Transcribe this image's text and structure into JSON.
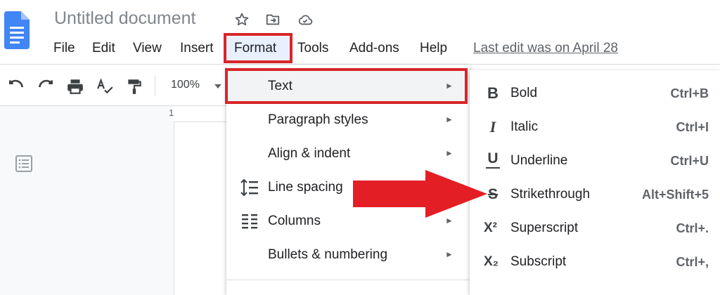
{
  "header": {
    "title": "Untitled document",
    "last_edit": "Last edit was on April 28"
  },
  "menubar": {
    "items": [
      "File",
      "Edit",
      "View",
      "Insert",
      "Format",
      "Tools",
      "Add-ons",
      "Help"
    ]
  },
  "toolbar": {
    "zoom": "100%"
  },
  "ruler": {
    "marker": "1"
  },
  "format_menu": {
    "items": [
      {
        "label": "Text"
      },
      {
        "label": "Paragraph styles"
      },
      {
        "label": "Align & indent"
      },
      {
        "label": "Line spacing"
      },
      {
        "label": "Columns"
      },
      {
        "label": "Bullets & numbering"
      }
    ],
    "arrow": "►"
  },
  "text_menu": {
    "items": [
      {
        "label": "Bold",
        "shortcut": "Ctrl+B",
        "icon": "B"
      },
      {
        "label": "Italic",
        "shortcut": "Ctrl+I",
        "icon": "I"
      },
      {
        "label": "Underline",
        "shortcut": "Ctrl+U",
        "icon": "U"
      },
      {
        "label": "Strikethrough",
        "shortcut": "Alt+Shift+5",
        "icon": "S"
      },
      {
        "label": "Superscript",
        "shortcut": "Ctrl+.",
        "icon": "X²"
      },
      {
        "label": "Subscript",
        "shortcut": "Ctrl+,",
        "icon": "X₂"
      }
    ]
  },
  "colors": {
    "highlight": "#d7262a",
    "docs_blue": "#4285f4",
    "hover": "#f1f3f4"
  }
}
